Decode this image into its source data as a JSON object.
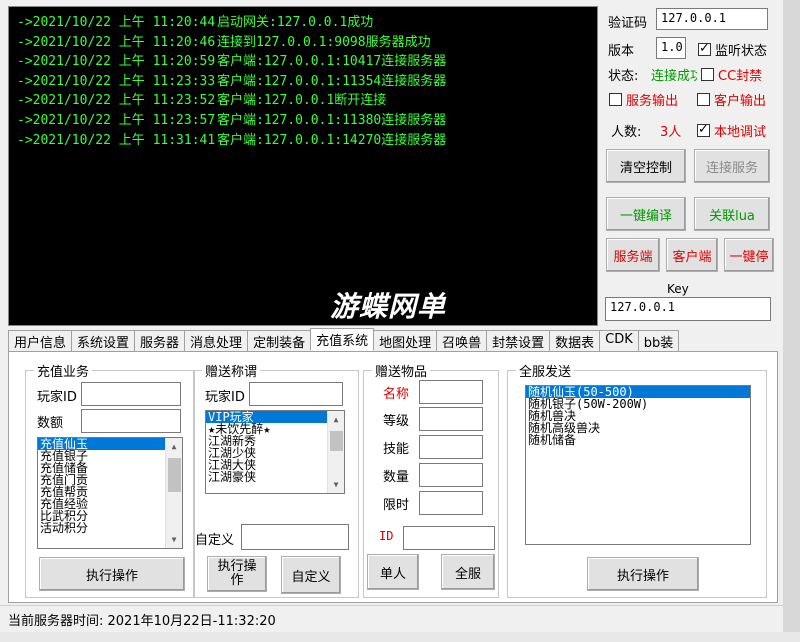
{
  "log": [
    {
      "ts": "->2021/10/22 上午 11:20:44",
      "msg": "启动网关:127.0.0.1成功"
    },
    {
      "ts": "->2021/10/22 上午 11:20:46",
      "msg": "连接到127.0.0.1:9098服务器成功"
    },
    {
      "ts": "->2021/10/22 上午 11:20:59",
      "msg": "客户端:127.0.0.1:10417连接服务器"
    },
    {
      "ts": "->2021/10/22 上午 11:23:33",
      "msg": "客户端:127.0.0.1:11354连接服务器"
    },
    {
      "ts": "->2021/10/22 上午 11:23:52",
      "msg": "客户端:127.0.0.1断开连接"
    },
    {
      "ts": "->2021/10/22 上午 11:23:57",
      "msg": "客户端:127.0.0.1:11380连接服务器"
    },
    {
      "ts": "->2021/10/22 上午 11:31:41",
      "msg": "客户端:127.0.0.1:14270连接服务器"
    }
  ],
  "watermark": "游蝶网单",
  "right": {
    "verify_label": "验证码",
    "verify_value": "127.0.0.1",
    "version_label": "版本",
    "version_value": "1.0",
    "listen_label": "监听状态",
    "status_label": "状态:",
    "status_value": "连接成功",
    "cc_label": "CC封禁",
    "svc_out_label": "服务输出",
    "client_out_label": "客户输出",
    "people_label": "人数:",
    "people_value": "3人",
    "local_debug_label": "本地调试",
    "clear_btn": "清空控制",
    "connect_btn": "连接服务",
    "compile_btn": "一键编译",
    "lua_btn": "关联lua",
    "server_btn": "服务端",
    "client_btn": "客户端",
    "stop_btn": "一键停",
    "key_label": "Key",
    "key_value": "127.0.0.1"
  },
  "tabs": [
    "用户信息",
    "系统设置",
    "服务器",
    "消息处理",
    "定制装备",
    "充值系统",
    "地图处理",
    "召唤兽",
    "封禁设置",
    "数据表",
    "CDK",
    "bb装"
  ],
  "active_tab": 5,
  "recharge": {
    "title": "充值业务",
    "player_label": "玩家ID",
    "amount_label": "数额",
    "items": [
      "充值仙玉",
      "充值银子",
      "充值储备",
      "充值门贡",
      "充值帮贡",
      "充值经验",
      "比武积分",
      "活动积分"
    ],
    "exec_btn": "执行操作"
  },
  "title_gift": {
    "title": "赠送称谓",
    "player_label": "玩家ID",
    "items": [
      "VIP玩家",
      "★未饮先醉★",
      "江湖新秀",
      "江湖少侠",
      "江湖大侠",
      "江湖豪侠"
    ],
    "custom_label": "自定义",
    "exec_btn": "执行操作",
    "custom_btn": "自定义"
  },
  "item_gift": {
    "title": "赠送物品",
    "name_label": "名称",
    "level_label": "等级",
    "skill_label": "技能",
    "qty_label": "数量",
    "time_label": "限时",
    "id_label": "ID",
    "single_btn": "单人",
    "all_btn": "全服"
  },
  "server_send": {
    "title": "全服发送",
    "items": [
      "随机仙玉(50-500)",
      "随机银子(50W-200W)",
      "随机兽决",
      "随机高级兽决",
      "随机储备"
    ],
    "exec_btn": "执行操作"
  },
  "status_bar": "当前服务器时间:  2021年10月22日-11:32:20"
}
